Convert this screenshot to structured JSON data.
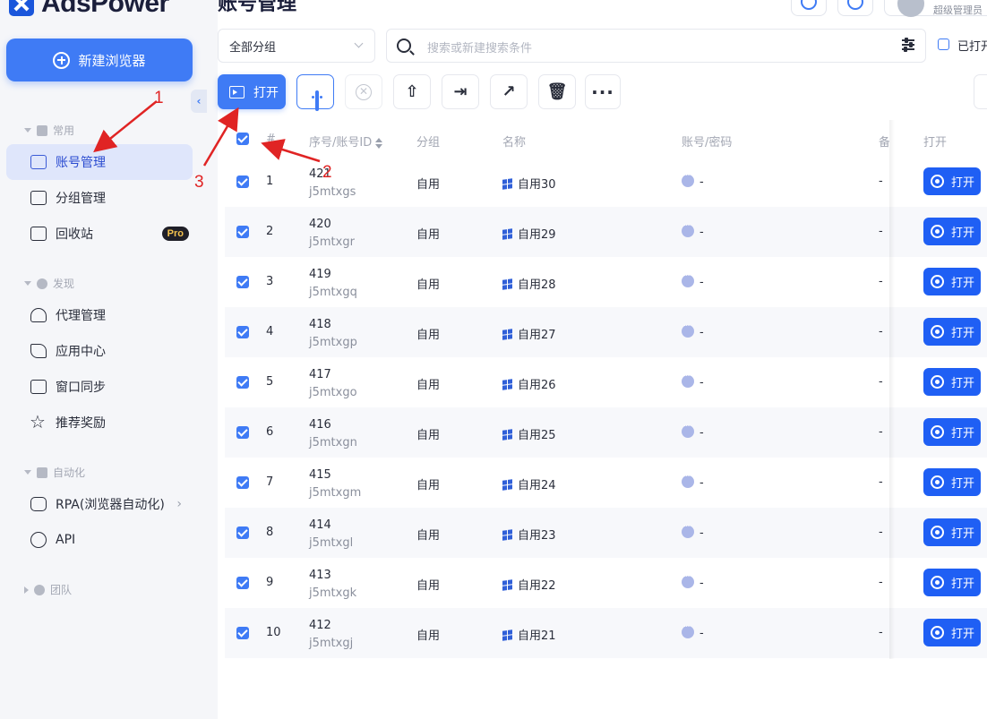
{
  "app": {
    "brand": "AdsPower",
    "page_title": "账号管理",
    "user_role": "超级管理员"
  },
  "sidebar": {
    "new_browser_label": "新建浏览器",
    "sections": {
      "common": "常用",
      "discover": "发现",
      "automation": "自动化",
      "team": "团队"
    },
    "items": {
      "account_mgmt": "账号管理",
      "group_mgmt": "分组管理",
      "recycle_bin": "回收站",
      "proxy_mgmt": "代理管理",
      "app_center": "应用中心",
      "window_sync": "窗口同步",
      "referral": "推荐奖励",
      "rpa": "RPA(浏览器自动化)",
      "api": "API"
    },
    "pro_badge": "Pro"
  },
  "filters": {
    "group_select": "全部分组",
    "search_placeholder": "搜索或新建搜索条件",
    "opened_label": "已打开"
  },
  "toolbar": {
    "open_label": "打开"
  },
  "table": {
    "headers": {
      "index": "#",
      "serial": "序号/账号ID",
      "group": "分组",
      "name": "名称",
      "credentials": "账号/密码",
      "remark": "备注",
      "open": "打开"
    },
    "rows": [
      {
        "index": "1",
        "serial": "421",
        "account_id": "j5mtxgs",
        "group": "自用",
        "name": "自用30",
        "credentials": "-",
        "remark": "-",
        "action": "打开"
      },
      {
        "index": "2",
        "serial": "420",
        "account_id": "j5mtxgr",
        "group": "自用",
        "name": "自用29",
        "credentials": "-",
        "remark": "-",
        "action": "打开"
      },
      {
        "index": "3",
        "serial": "419",
        "account_id": "j5mtxgq",
        "group": "自用",
        "name": "自用28",
        "credentials": "-",
        "remark": "-",
        "action": "打开"
      },
      {
        "index": "4",
        "serial": "418",
        "account_id": "j5mtxgp",
        "group": "自用",
        "name": "自用27",
        "credentials": "-",
        "remark": "-",
        "action": "打开"
      },
      {
        "index": "5",
        "serial": "417",
        "account_id": "j5mtxgo",
        "group": "自用",
        "name": "自用26",
        "credentials": "-",
        "remark": "-",
        "action": "打开"
      },
      {
        "index": "6",
        "serial": "416",
        "account_id": "j5mtxgn",
        "group": "自用",
        "name": "自用25",
        "credentials": "-",
        "remark": "-",
        "action": "打开"
      },
      {
        "index": "7",
        "serial": "415",
        "account_id": "j5mtxgm",
        "group": "自用",
        "name": "自用24",
        "credentials": "-",
        "remark": "-",
        "action": "打开"
      },
      {
        "index": "8",
        "serial": "414",
        "account_id": "j5mtxgl",
        "group": "自用",
        "name": "自用23",
        "credentials": "-",
        "remark": "-",
        "action": "打开"
      },
      {
        "index": "9",
        "serial": "413",
        "account_id": "j5mtxgk",
        "group": "自用",
        "name": "自用22",
        "credentials": "-",
        "remark": "-",
        "action": "打开"
      },
      {
        "index": "10",
        "serial": "412",
        "account_id": "j5mtxgj",
        "group": "自用",
        "name": "自用21",
        "credentials": "-",
        "remark": "-",
        "action": "打开"
      }
    ]
  },
  "annotations": {
    "n1": "1",
    "n2": "2",
    "n3": "3",
    "color": "#e02424"
  },
  "colors": {
    "accent": "#3f7bf5",
    "open_button": "#1f5ff4",
    "active_nav_bg": "#dfe6fb"
  }
}
